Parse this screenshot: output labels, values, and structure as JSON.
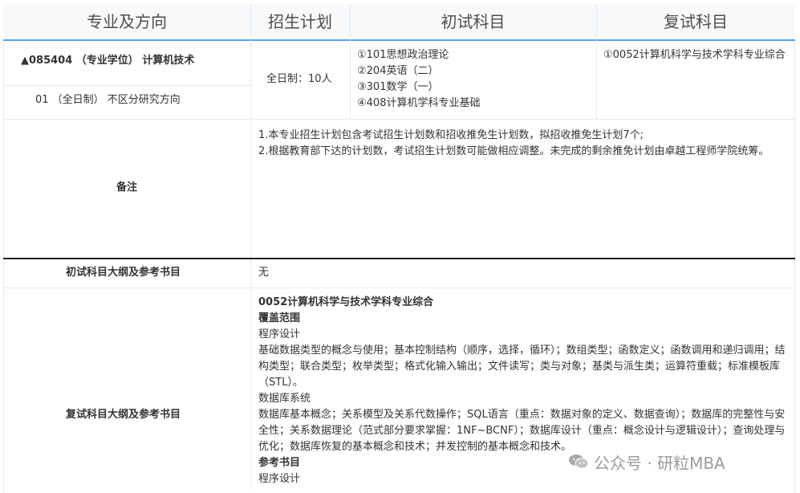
{
  "header": {
    "col1": "专业及方向",
    "col2": "招生计划",
    "col3": "初试科目",
    "col4": "复试科目"
  },
  "program": {
    "title": "▲085404 （专业学位） 计算机技术",
    "direction": "01 （全日制） 不区分研究方向",
    "plan": "全日制：10人",
    "initial_subjects": [
      "①101思想政治理论",
      "②204英语（二）",
      "③301数学（一）",
      "④408计算机学科专业基础"
    ],
    "retest_subject": "①0052计算机科学与技术学科专业综合"
  },
  "notes": {
    "label": "备注",
    "lines": [
      "1.本专业招生计划包含考试招生计划数和招收推免生计划数，拟招收推免生计划7个;",
      "2.根据教育部下达的计划数，考试招生计划数可能做相应调整。未完成的剩余推免计划由卓越工程师学院统筹。"
    ]
  },
  "initial_outline": {
    "label": "初试科目大纲及参考书目",
    "value": "无"
  },
  "retest_outline": {
    "label": "复试科目大纲及参考书目",
    "title": "0052计算机科学与技术学科专业综合",
    "coverage_heading": "覆盖范围",
    "section1_title": "程序设计",
    "section1_body": "基础数据类型的概念与使用；基本控制结构（顺序，选择，循环）；数组类型；函数定义；函数调用和递归调用；结构类型；联合类型；枚举类型；格式化输入输出；文件读写；类与对象；基类与派生类；运算符重载；标准模板库（STL）。",
    "section2_title": "数据库系统",
    "section2_body": "数据库基本概念；关系模型及关系代数操作；SQL语言（重点：数据对象的定义、数据查询）；数据库的完整性与安全性；关系数据理论（范式部分要求掌握：1NF~BCNF）；数据库设计（重点：概念设计与逻辑设计）；查询处理与优化；数据库恢复的基本概念和技术；并发控制的基本概念和技术。",
    "ref_heading": "参考书目",
    "ref_first": "程序设计"
  },
  "watermark": {
    "text": "公众号 · 研粒MBA",
    "icon": "wechat-icon"
  }
}
